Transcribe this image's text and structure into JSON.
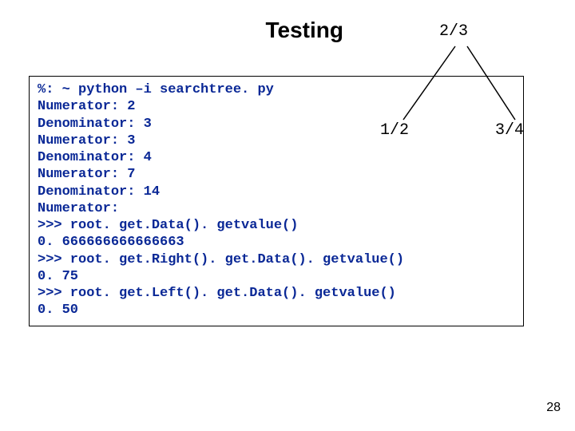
{
  "title": "Testing",
  "page_number": "28",
  "code": {
    "l0": "%: ~ python –i searchtree. py",
    "l1": "Numerator: 2",
    "l2": "Denominator: 3",
    "l3": "Numerator: 3",
    "l4": "Denominator: 4",
    "l5": "Numerator: 7",
    "l6": "Denominator: 14",
    "l7": "Numerator:",
    "l8": ">>> root. get.Data(). getvalue()",
    "l9": "0. 666666666666663",
    "l10": ">>> root. get.Right(). get.Data(). getvalue()",
    "l11": "0. 75",
    "l12": ">>> root. get.Left(). get.Data(). getvalue()",
    "l13": "0. 50"
  },
  "tree": {
    "root": "2/3",
    "left": "1/2",
    "right": "3/4"
  }
}
